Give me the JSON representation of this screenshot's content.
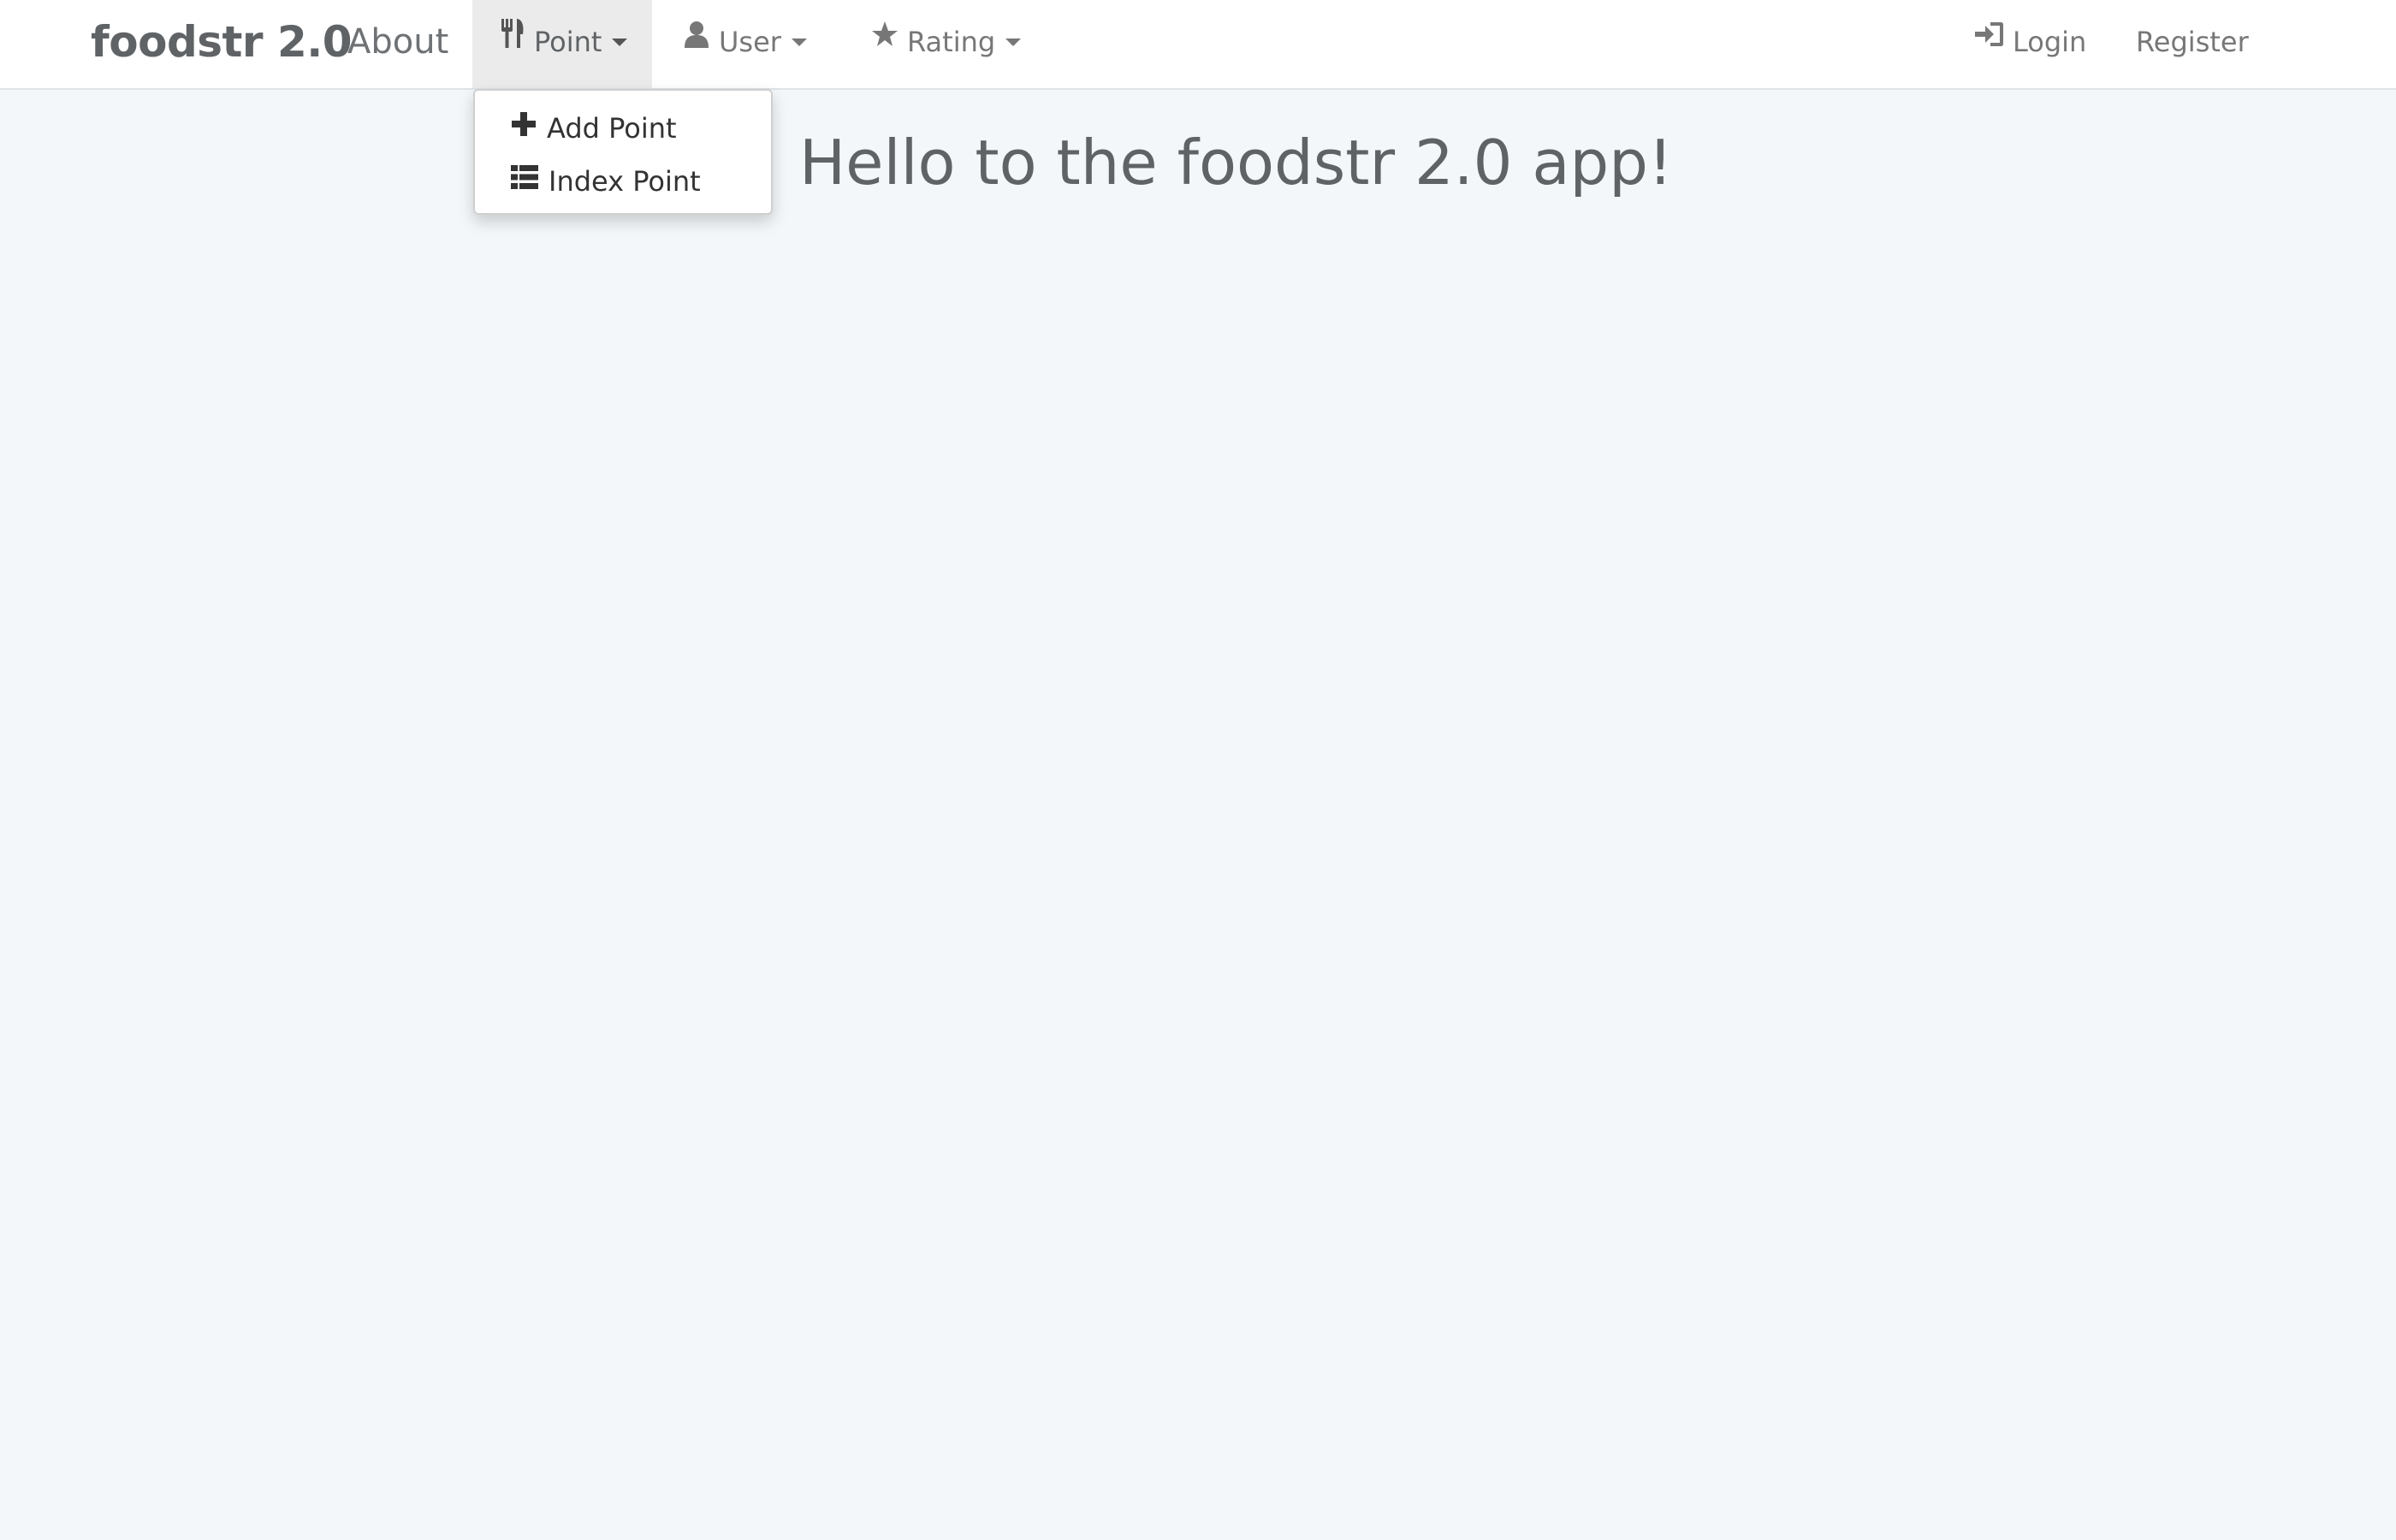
{
  "navbar": {
    "brand": "foodstr 2.0",
    "about": "About",
    "point": {
      "label": "Point",
      "icon": "cutlery-icon"
    },
    "user": {
      "label": "User",
      "icon": "user-icon"
    },
    "rating": {
      "label": "Rating",
      "icon": "star-icon"
    },
    "login": {
      "label": "Login",
      "icon": "login-icon"
    },
    "register": "Register"
  },
  "point_menu": {
    "open": true,
    "items": [
      {
        "label": "Add Point",
        "icon": "plus-icon"
      },
      {
        "label": "Index Point",
        "icon": "list-icon"
      }
    ]
  },
  "main": {
    "heading": "Hello to the foodstr 2.0 app!"
  },
  "colors": {
    "background": "#f3f7fa",
    "navbar": "#ffffff",
    "active_tab": "#ebebeb"
  }
}
